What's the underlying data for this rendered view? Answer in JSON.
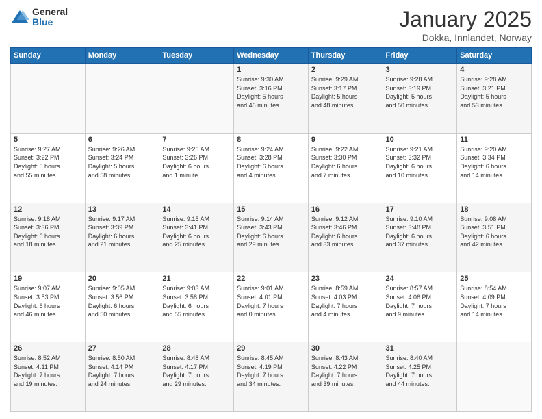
{
  "logo": {
    "general": "General",
    "blue": "Blue"
  },
  "header": {
    "month": "January 2025",
    "location": "Dokka, Innlandet, Norway"
  },
  "days_of_week": [
    "Sunday",
    "Monday",
    "Tuesday",
    "Wednesday",
    "Thursday",
    "Friday",
    "Saturday"
  ],
  "weeks": [
    [
      {
        "day": "",
        "info": ""
      },
      {
        "day": "",
        "info": ""
      },
      {
        "day": "",
        "info": ""
      },
      {
        "day": "1",
        "info": "Sunrise: 9:30 AM\nSunset: 3:16 PM\nDaylight: 5 hours\nand 46 minutes."
      },
      {
        "day": "2",
        "info": "Sunrise: 9:29 AM\nSunset: 3:17 PM\nDaylight: 5 hours\nand 48 minutes."
      },
      {
        "day": "3",
        "info": "Sunrise: 9:28 AM\nSunset: 3:19 PM\nDaylight: 5 hours\nand 50 minutes."
      },
      {
        "day": "4",
        "info": "Sunrise: 9:28 AM\nSunset: 3:21 PM\nDaylight: 5 hours\nand 53 minutes."
      }
    ],
    [
      {
        "day": "5",
        "info": "Sunrise: 9:27 AM\nSunset: 3:22 PM\nDaylight: 5 hours\nand 55 minutes."
      },
      {
        "day": "6",
        "info": "Sunrise: 9:26 AM\nSunset: 3:24 PM\nDaylight: 5 hours\nand 58 minutes."
      },
      {
        "day": "7",
        "info": "Sunrise: 9:25 AM\nSunset: 3:26 PM\nDaylight: 6 hours\nand 1 minute."
      },
      {
        "day": "8",
        "info": "Sunrise: 9:24 AM\nSunset: 3:28 PM\nDaylight: 6 hours\nand 4 minutes."
      },
      {
        "day": "9",
        "info": "Sunrise: 9:22 AM\nSunset: 3:30 PM\nDaylight: 6 hours\nand 7 minutes."
      },
      {
        "day": "10",
        "info": "Sunrise: 9:21 AM\nSunset: 3:32 PM\nDaylight: 6 hours\nand 10 minutes."
      },
      {
        "day": "11",
        "info": "Sunrise: 9:20 AM\nSunset: 3:34 PM\nDaylight: 6 hours\nand 14 minutes."
      }
    ],
    [
      {
        "day": "12",
        "info": "Sunrise: 9:18 AM\nSunset: 3:36 PM\nDaylight: 6 hours\nand 18 minutes."
      },
      {
        "day": "13",
        "info": "Sunrise: 9:17 AM\nSunset: 3:39 PM\nDaylight: 6 hours\nand 21 minutes."
      },
      {
        "day": "14",
        "info": "Sunrise: 9:15 AM\nSunset: 3:41 PM\nDaylight: 6 hours\nand 25 minutes."
      },
      {
        "day": "15",
        "info": "Sunrise: 9:14 AM\nSunset: 3:43 PM\nDaylight: 6 hours\nand 29 minutes."
      },
      {
        "day": "16",
        "info": "Sunrise: 9:12 AM\nSunset: 3:46 PM\nDaylight: 6 hours\nand 33 minutes."
      },
      {
        "day": "17",
        "info": "Sunrise: 9:10 AM\nSunset: 3:48 PM\nDaylight: 6 hours\nand 37 minutes."
      },
      {
        "day": "18",
        "info": "Sunrise: 9:08 AM\nSunset: 3:51 PM\nDaylight: 6 hours\nand 42 minutes."
      }
    ],
    [
      {
        "day": "19",
        "info": "Sunrise: 9:07 AM\nSunset: 3:53 PM\nDaylight: 6 hours\nand 46 minutes."
      },
      {
        "day": "20",
        "info": "Sunrise: 9:05 AM\nSunset: 3:56 PM\nDaylight: 6 hours\nand 50 minutes."
      },
      {
        "day": "21",
        "info": "Sunrise: 9:03 AM\nSunset: 3:58 PM\nDaylight: 6 hours\nand 55 minutes."
      },
      {
        "day": "22",
        "info": "Sunrise: 9:01 AM\nSunset: 4:01 PM\nDaylight: 7 hours\nand 0 minutes."
      },
      {
        "day": "23",
        "info": "Sunrise: 8:59 AM\nSunset: 4:03 PM\nDaylight: 7 hours\nand 4 minutes."
      },
      {
        "day": "24",
        "info": "Sunrise: 8:57 AM\nSunset: 4:06 PM\nDaylight: 7 hours\nand 9 minutes."
      },
      {
        "day": "25",
        "info": "Sunrise: 8:54 AM\nSunset: 4:09 PM\nDaylight: 7 hours\nand 14 minutes."
      }
    ],
    [
      {
        "day": "26",
        "info": "Sunrise: 8:52 AM\nSunset: 4:11 PM\nDaylight: 7 hours\nand 19 minutes."
      },
      {
        "day": "27",
        "info": "Sunrise: 8:50 AM\nSunset: 4:14 PM\nDaylight: 7 hours\nand 24 minutes."
      },
      {
        "day": "28",
        "info": "Sunrise: 8:48 AM\nSunset: 4:17 PM\nDaylight: 7 hours\nand 29 minutes."
      },
      {
        "day": "29",
        "info": "Sunrise: 8:45 AM\nSunset: 4:19 PM\nDaylight: 7 hours\nand 34 minutes."
      },
      {
        "day": "30",
        "info": "Sunrise: 8:43 AM\nSunset: 4:22 PM\nDaylight: 7 hours\nand 39 minutes."
      },
      {
        "day": "31",
        "info": "Sunrise: 8:40 AM\nSunset: 4:25 PM\nDaylight: 7 hours\nand 44 minutes."
      },
      {
        "day": "",
        "info": ""
      }
    ]
  ]
}
